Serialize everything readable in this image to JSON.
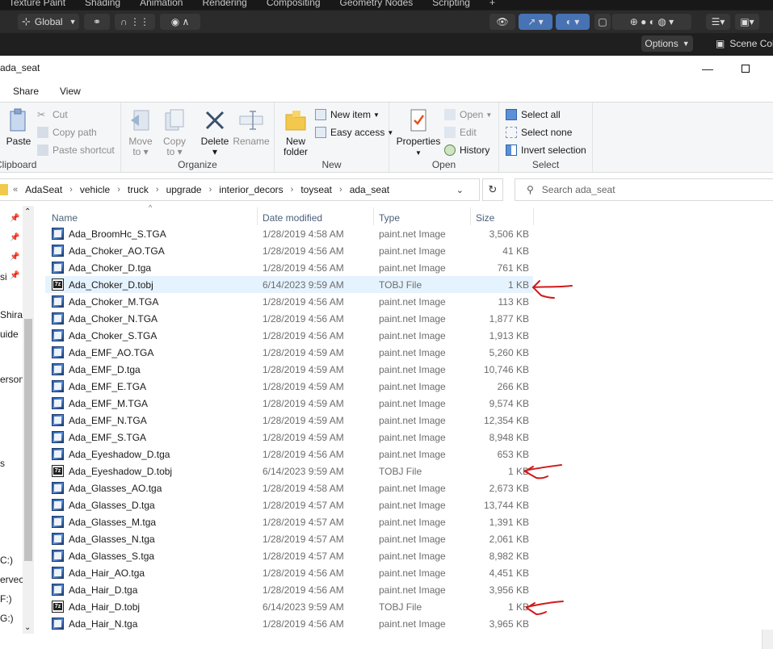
{
  "blender": {
    "tabs": [
      "Texture Paint",
      "Shading",
      "Animation",
      "Rendering",
      "Compositing",
      "Geometry Nodes",
      "Scripting",
      "+"
    ],
    "transform_orientation": "Global",
    "options_label": "Options",
    "scene_label": "Scene Col"
  },
  "explorer": {
    "window_title": "ada_seat",
    "menu_tabs": [
      "Share",
      "View"
    ],
    "ribbon": {
      "clipboard": {
        "paste": "Paste",
        "cut": "Cut",
        "copy_path": "Copy path",
        "paste_shortcut": "Paste shortcut",
        "group_label": "Clipboard"
      },
      "organize": {
        "move_to": "Move to",
        "copy_to": "Copy to",
        "delete": "Delete",
        "rename": "Rename",
        "group_label": "Organize"
      },
      "new": {
        "new_folder": "New folder",
        "new_item": "New item",
        "easy_access": "Easy access",
        "group_label": "New"
      },
      "open": {
        "properties": "Properties",
        "open": "Open",
        "edit": "Edit",
        "history": "History",
        "group_label": "Open"
      },
      "select": {
        "select_all": "Select all",
        "select_none": "Select none",
        "invert_selection": "Invert selection",
        "group_label": "Select"
      }
    },
    "breadcrumb": [
      "AdaSeat",
      "vehicle",
      "truck",
      "upgrade",
      "interior_decors",
      "toyseat",
      "ada_seat"
    ],
    "search_placeholder": "Search ada_seat",
    "nav_labels": [
      "si",
      "Shiran",
      "uide",
      "erson",
      "s",
      "C:)",
      "ervec",
      "F:)",
      "G:)"
    ],
    "columns": {
      "name": "Name",
      "date": "Date modified",
      "type": "Type",
      "size": "Size"
    },
    "files": [
      {
        "name": "Ada_BroomHc_S.TGA",
        "date": "1/28/2019 4:58 AM",
        "type": "paint.net Image",
        "size": "3,506 KB",
        "kind": "image"
      },
      {
        "name": "Ada_Choker_AO.TGA",
        "date": "1/28/2019 4:56 AM",
        "type": "paint.net Image",
        "size": "41 KB",
        "kind": "image"
      },
      {
        "name": "Ada_Choker_D.tga",
        "date": "1/28/2019 4:56 AM",
        "type": "paint.net Image",
        "size": "761 KB",
        "kind": "image"
      },
      {
        "name": "Ada_Choker_D.tobj",
        "date": "6/14/2023 9:59 AM",
        "type": "TOBJ File",
        "size": "1 KB",
        "kind": "tobj",
        "selected": true
      },
      {
        "name": "Ada_Choker_M.TGA",
        "date": "1/28/2019 4:56 AM",
        "type": "paint.net Image",
        "size": "113 KB",
        "kind": "image"
      },
      {
        "name": "Ada_Choker_N.TGA",
        "date": "1/28/2019 4:56 AM",
        "type": "paint.net Image",
        "size": "1,877 KB",
        "kind": "image"
      },
      {
        "name": "Ada_Choker_S.TGA",
        "date": "1/28/2019 4:56 AM",
        "type": "paint.net Image",
        "size": "1,913 KB",
        "kind": "image"
      },
      {
        "name": "Ada_EMF_AO.TGA",
        "date": "1/28/2019 4:59 AM",
        "type": "paint.net Image",
        "size": "5,260 KB",
        "kind": "image"
      },
      {
        "name": "Ada_EMF_D.tga",
        "date": "1/28/2019 4:59 AM",
        "type": "paint.net Image",
        "size": "10,746 KB",
        "kind": "image"
      },
      {
        "name": "Ada_EMF_E.TGA",
        "date": "1/28/2019 4:59 AM",
        "type": "paint.net Image",
        "size": "266 KB",
        "kind": "image"
      },
      {
        "name": "Ada_EMF_M.TGA",
        "date": "1/28/2019 4:59 AM",
        "type": "paint.net Image",
        "size": "9,574 KB",
        "kind": "image"
      },
      {
        "name": "Ada_EMF_N.TGA",
        "date": "1/28/2019 4:59 AM",
        "type": "paint.net Image",
        "size": "12,354 KB",
        "kind": "image"
      },
      {
        "name": "Ada_EMF_S.TGA",
        "date": "1/28/2019 4:59 AM",
        "type": "paint.net Image",
        "size": "8,948 KB",
        "kind": "image"
      },
      {
        "name": "Ada_Eyeshadow_D.tga",
        "date": "1/28/2019 4:56 AM",
        "type": "paint.net Image",
        "size": "653 KB",
        "kind": "image"
      },
      {
        "name": "Ada_Eyeshadow_D.tobj",
        "date": "6/14/2023 9:59 AM",
        "type": "TOBJ File",
        "size": "1 KB",
        "kind": "tobj"
      },
      {
        "name": "Ada_Glasses_AO.tga",
        "date": "1/28/2019 4:58 AM",
        "type": "paint.net Image",
        "size": "2,673 KB",
        "kind": "image"
      },
      {
        "name": "Ada_Glasses_D.tga",
        "date": "1/28/2019 4:57 AM",
        "type": "paint.net Image",
        "size": "13,744 KB",
        "kind": "image"
      },
      {
        "name": "Ada_Glasses_M.tga",
        "date": "1/28/2019 4:57 AM",
        "type": "paint.net Image",
        "size": "1,391 KB",
        "kind": "image"
      },
      {
        "name": "Ada_Glasses_N.tga",
        "date": "1/28/2019 4:57 AM",
        "type": "paint.net Image",
        "size": "2,061 KB",
        "kind": "image"
      },
      {
        "name": "Ada_Glasses_S.tga",
        "date": "1/28/2019 4:57 AM",
        "type": "paint.net Image",
        "size": "8,982 KB",
        "kind": "image"
      },
      {
        "name": "Ada_Hair_AO.tga",
        "date": "1/28/2019 4:56 AM",
        "type": "paint.net Image",
        "size": "4,451 KB",
        "kind": "image"
      },
      {
        "name": "Ada_Hair_D.tga",
        "date": "1/28/2019 4:56 AM",
        "type": "paint.net Image",
        "size": "3,956 KB",
        "kind": "image"
      },
      {
        "name": "Ada_Hair_D.tobj",
        "date": "6/14/2023 9:59 AM",
        "type": "TOBJ File",
        "size": "1 KB",
        "kind": "tobj"
      },
      {
        "name": "Ada_Hair_N.tga",
        "date": "1/28/2019 4:56 AM",
        "type": "paint.net Image",
        "size": "3,965 KB",
        "kind": "image"
      }
    ],
    "annotation_color": "#d11a1a"
  }
}
